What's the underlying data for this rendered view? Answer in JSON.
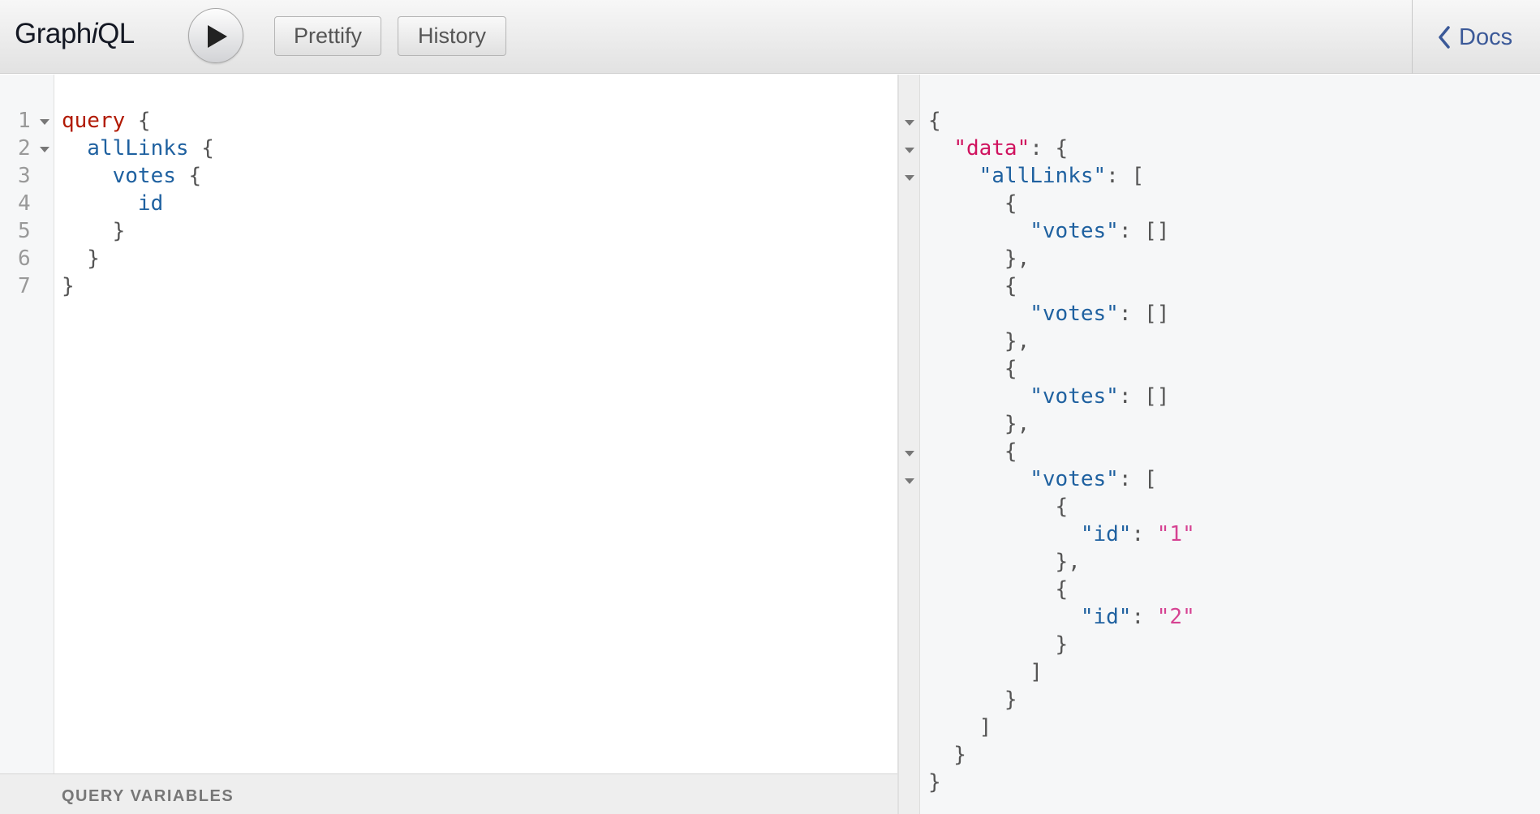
{
  "app": {
    "title_prefix": "Graph",
    "title_italic": "i",
    "title_suffix": "QL"
  },
  "toolbar": {
    "run_icon": "play-icon",
    "prettify_label": "Prettify",
    "history_label": "History",
    "docs_label": "Docs",
    "docs_icon": "chevron-left-icon"
  },
  "editor": {
    "line_numbers": [
      "1",
      "2",
      "3",
      "4",
      "5",
      "6",
      "7"
    ],
    "lines": [
      {
        "kw": "query",
        "field": "",
        "punct": " {"
      },
      {
        "kw": "",
        "field": "  allLinks",
        "punct": " {"
      },
      {
        "kw": "",
        "field": "    votes",
        "punct": " {"
      },
      {
        "kw": "",
        "field": "      id",
        "punct": ""
      },
      {
        "kw": "",
        "field": "",
        "punct": "    }"
      },
      {
        "kw": "",
        "field": "",
        "punct": "  }"
      },
      {
        "kw": "",
        "field": "",
        "punct": "}"
      }
    ]
  },
  "variables": {
    "title": "QUERY VARIABLES"
  },
  "result": {
    "lines": [
      {
        "p1": "{",
        "key": "",
        "keyclass": "",
        "p2": "",
        "str": "",
        "p3": ""
      },
      {
        "p1": "  ",
        "key": "\"data\"",
        "keyclass": "jkey-data",
        "p2": ": {",
        "str": "",
        "p3": ""
      },
      {
        "p1": "    ",
        "key": "\"allLinks\"",
        "keyclass": "jkey",
        "p2": ": [",
        "str": "",
        "p3": ""
      },
      {
        "p1": "      {",
        "key": "",
        "keyclass": "",
        "p2": "",
        "str": "",
        "p3": ""
      },
      {
        "p1": "        ",
        "key": "\"votes\"",
        "keyclass": "jkey",
        "p2": ": []",
        "str": "",
        "p3": ""
      },
      {
        "p1": "      },",
        "key": "",
        "keyclass": "",
        "p2": "",
        "str": "",
        "p3": ""
      },
      {
        "p1": "      {",
        "key": "",
        "keyclass": "",
        "p2": "",
        "str": "",
        "p3": ""
      },
      {
        "p1": "        ",
        "key": "\"votes\"",
        "keyclass": "jkey",
        "p2": ": []",
        "str": "",
        "p3": ""
      },
      {
        "p1": "      },",
        "key": "",
        "keyclass": "",
        "p2": "",
        "str": "",
        "p3": ""
      },
      {
        "p1": "      {",
        "key": "",
        "keyclass": "",
        "p2": "",
        "str": "",
        "p3": ""
      },
      {
        "p1": "        ",
        "key": "\"votes\"",
        "keyclass": "jkey",
        "p2": ": []",
        "str": "",
        "p3": ""
      },
      {
        "p1": "      },",
        "key": "",
        "keyclass": "",
        "p2": "",
        "str": "",
        "p3": ""
      },
      {
        "p1": "      {",
        "key": "",
        "keyclass": "",
        "p2": "",
        "str": "",
        "p3": ""
      },
      {
        "p1": "        ",
        "key": "\"votes\"",
        "keyclass": "jkey",
        "p2": ": [",
        "str": "",
        "p3": ""
      },
      {
        "p1": "          {",
        "key": "",
        "keyclass": "",
        "p2": "",
        "str": "",
        "p3": ""
      },
      {
        "p1": "            ",
        "key": "\"id\"",
        "keyclass": "jkey",
        "p2": ": ",
        "str": "\"1\"",
        "p3": ""
      },
      {
        "p1": "          },",
        "key": "",
        "keyclass": "",
        "p2": "",
        "str": "",
        "p3": ""
      },
      {
        "p1": "          {",
        "key": "",
        "keyclass": "",
        "p2": "",
        "str": "",
        "p3": ""
      },
      {
        "p1": "            ",
        "key": "\"id\"",
        "keyclass": "jkey",
        "p2": ": ",
        "str": "\"2\"",
        "p3": ""
      },
      {
        "p1": "          }",
        "key": "",
        "keyclass": "",
        "p2": "",
        "str": "",
        "p3": ""
      },
      {
        "p1": "        ]",
        "key": "",
        "keyclass": "",
        "p2": "",
        "str": "",
        "p3": ""
      },
      {
        "p1": "      }",
        "key": "",
        "keyclass": "",
        "p2": "",
        "str": "",
        "p3": ""
      },
      {
        "p1": "    ]",
        "key": "",
        "keyclass": "",
        "p2": "",
        "str": "",
        "p3": ""
      },
      {
        "p1": "  }",
        "key": "",
        "keyclass": "",
        "p2": "",
        "str": "",
        "p3": ""
      },
      {
        "p1": "}",
        "key": "",
        "keyclass": "",
        "p2": "",
        "str": "",
        "p3": ""
      }
    ]
  }
}
